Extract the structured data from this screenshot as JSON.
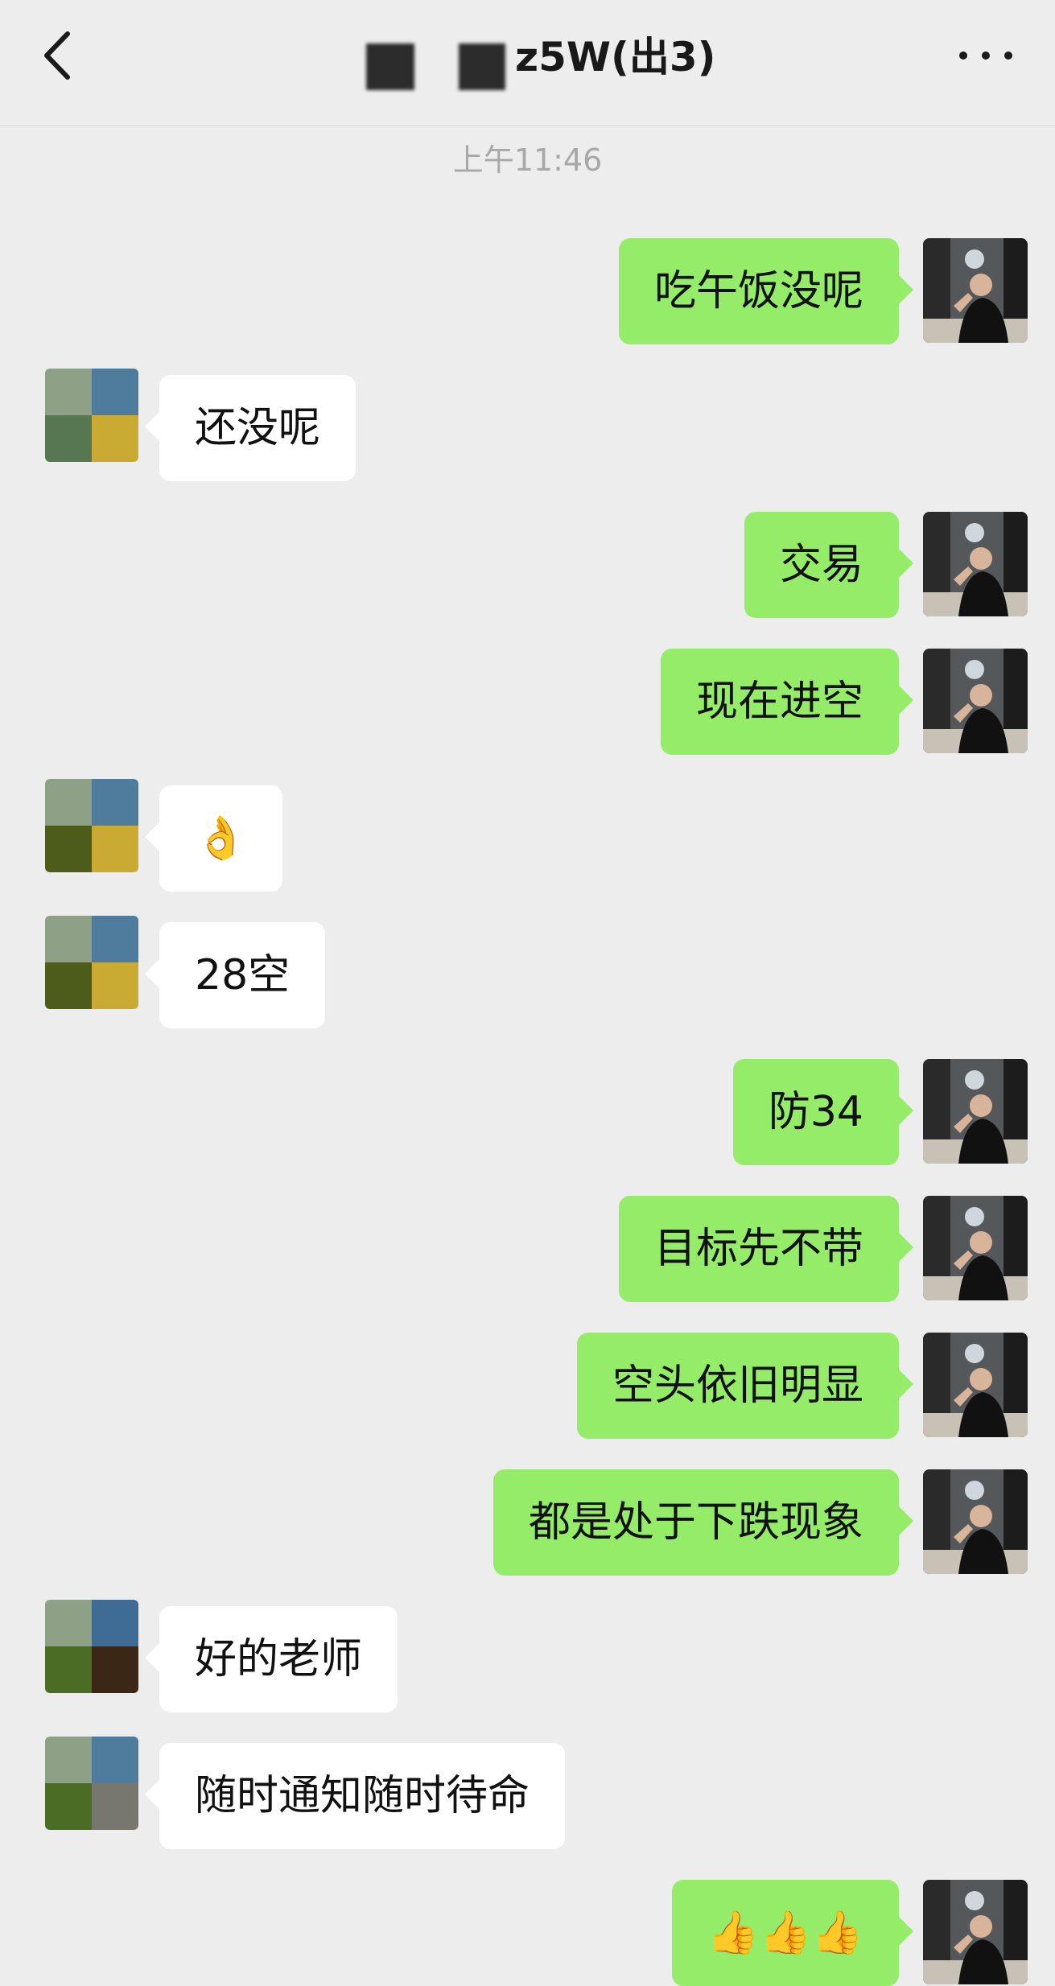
{
  "header": {
    "title": "z5W(出3)",
    "back_icon": "chevron-left-icon",
    "more_icon": "more-dots-icon"
  },
  "chat": {
    "timestamp": "上午11:46",
    "messages": [
      {
        "from": "me",
        "text": "吃午饭没呢"
      },
      {
        "from": "them",
        "text": "还没呢"
      },
      {
        "from": "me",
        "text": "交易"
      },
      {
        "from": "me",
        "text": "现在进空"
      },
      {
        "from": "them",
        "text": "👌"
      },
      {
        "from": "them",
        "text": "28空"
      },
      {
        "from": "me",
        "text": "防34"
      },
      {
        "from": "me",
        "text": "目标先不带"
      },
      {
        "from": "me",
        "text": "空头依旧明显"
      },
      {
        "from": "me",
        "text": "都是处于下跌现象"
      },
      {
        "from": "them",
        "text": "好的老师"
      },
      {
        "from": "them",
        "text": "随时通知随时待命"
      },
      {
        "from": "me",
        "text": "👍👍👍"
      }
    ]
  },
  "colors": {
    "background": "#ededed",
    "my_bubble": "#95ec69",
    "their_bubble": "#ffffff"
  }
}
